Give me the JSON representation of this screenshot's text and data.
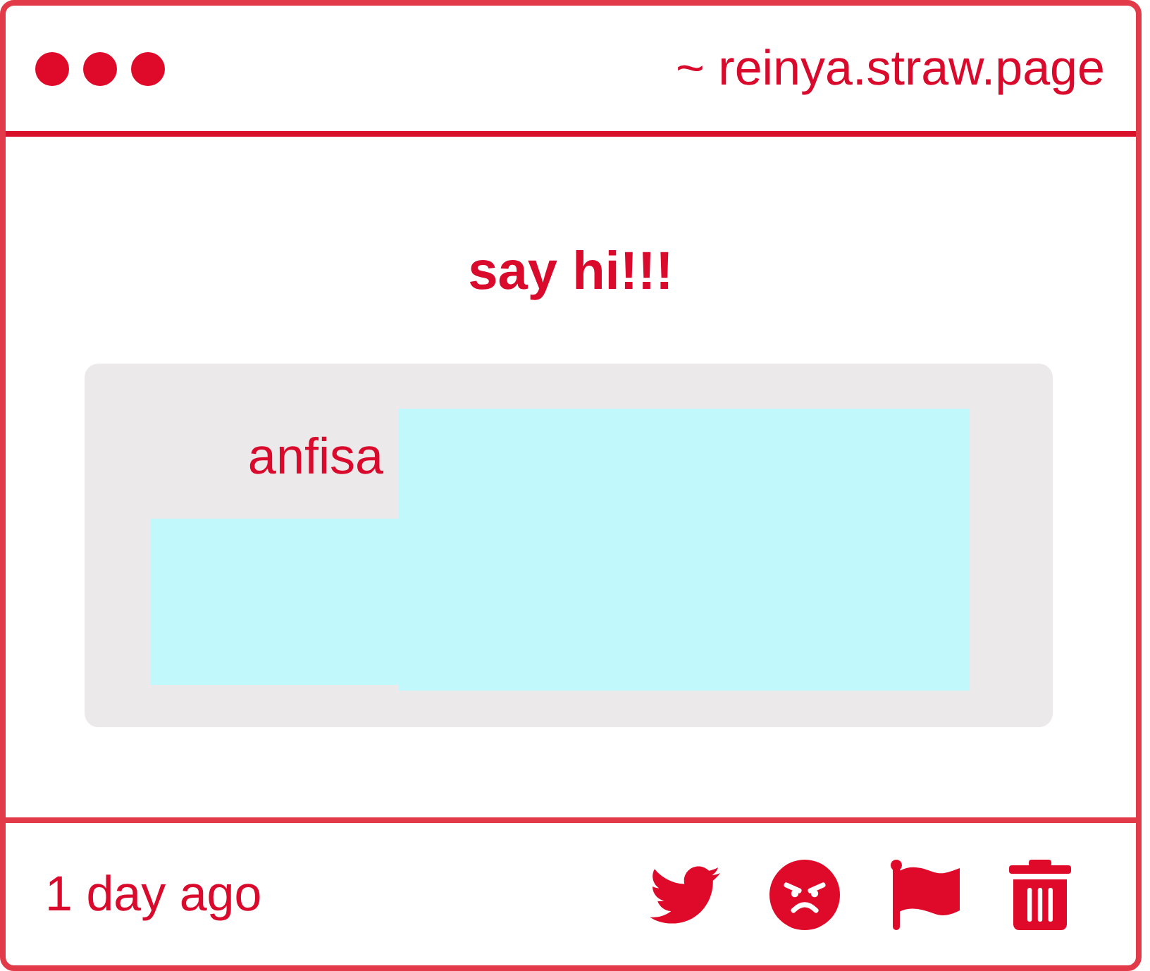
{
  "window": {
    "url": "~ reinya.straw.page"
  },
  "title": "say hi!!!",
  "message": {
    "author": "anfisa"
  },
  "footer": {
    "time": "1 day ago"
  }
}
